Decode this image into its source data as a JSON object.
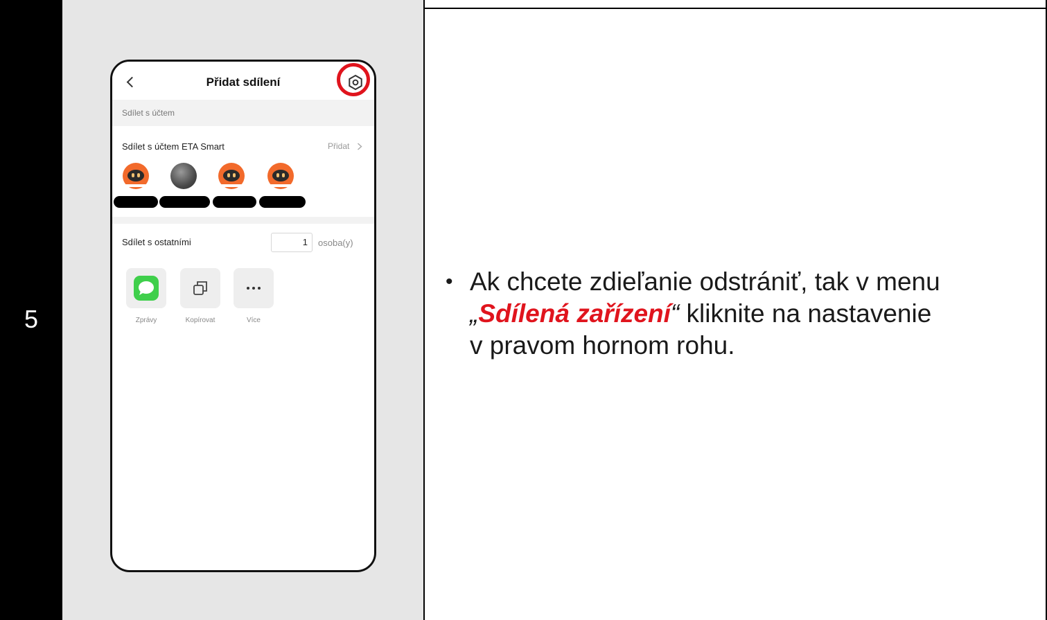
{
  "step": {
    "number": "5"
  },
  "phone": {
    "header": {
      "title": "Přidat sdílení",
      "back_icon": "chevron-left-icon",
      "settings_icon": "gear-icon"
    },
    "share_account_section": {
      "label": "Sdílet s účtem"
    },
    "eta_row": {
      "label": "Sdílet s účtem ETA Smart",
      "action": "Přidat",
      "action_icon": "chevron-right-icon"
    },
    "avatars": [
      "device-icon",
      "photo",
      "device-icon",
      "device-icon"
    ],
    "others_row": {
      "label": "Sdílet s ostatními",
      "count": "1",
      "unit": "osoba(y)"
    },
    "share_options": [
      {
        "label": "Zprávy",
        "icon": "message-icon",
        "color": "#3fcf4b"
      },
      {
        "label": "Kopírovat",
        "icon": "copy-icon"
      },
      {
        "label": "Více",
        "icon": "more-icon"
      }
    ],
    "highlight_color": "#e0141d"
  },
  "instruction": {
    "bullet": "•",
    "line1": "Ak chcete zdieľanie odstrániť, tak v menu",
    "quote_open": "„",
    "menu_name": "Sdílená zařízení",
    "quote_close": "“",
    "line2_rest": " kliknite na nastavenie",
    "line3": "v pravom hornom rohu."
  }
}
